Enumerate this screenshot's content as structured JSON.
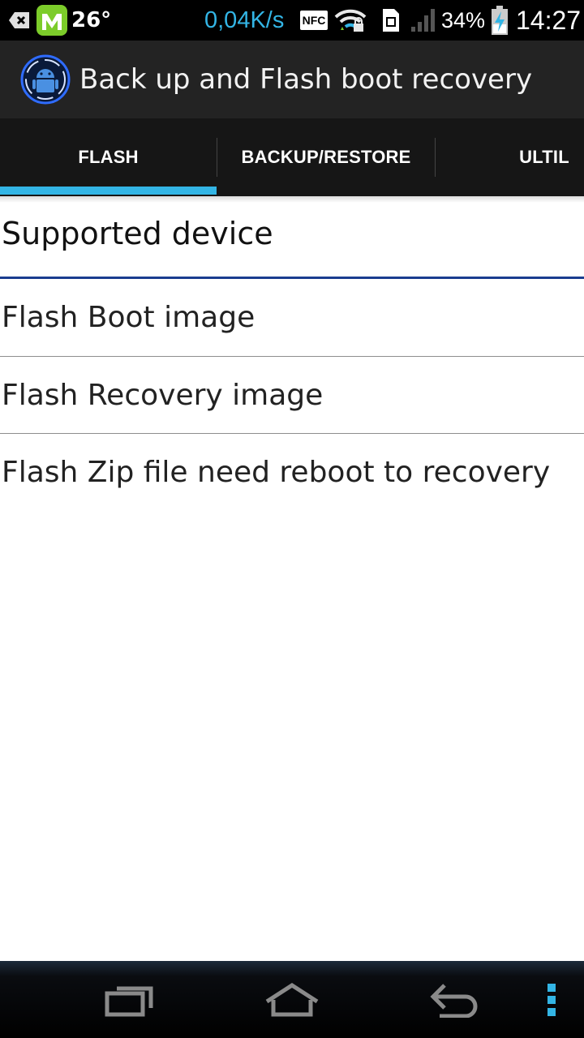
{
  "status_bar": {
    "temperature": "26°",
    "network_speed": "0,04K/s",
    "nfc_label": "NFC",
    "battery_percent": "34%",
    "clock": "14:27",
    "icons": [
      "back-badge-icon",
      "m-app-icon",
      "nfc-icon",
      "wifi-icon",
      "sim-card-icon",
      "signal-icon",
      "battery-charging-icon"
    ]
  },
  "action_bar": {
    "title": "Back up and Flash boot recovery",
    "icon": "android-app-icon"
  },
  "tabs": [
    {
      "label": "FLASH",
      "selected": true
    },
    {
      "label": "BACKUP/RESTORE",
      "selected": false
    },
    {
      "label": "ULTIL",
      "selected": false
    }
  ],
  "content": {
    "section_header": "Supported device",
    "items": [
      {
        "label": "Flash Boot image"
      },
      {
        "label": "Flash Recovery image"
      },
      {
        "label": "Flash Zip file need reboot to recovery"
      }
    ]
  },
  "nav_bar": {
    "buttons": [
      "recent-apps-icon",
      "home-icon",
      "back-icon",
      "overflow-menu-icon"
    ]
  },
  "colors": {
    "accent": "#33b5e5",
    "section_rule": "#1a3d8f",
    "action_bar_bg": "#232323",
    "tab_bar_bg": "#161616"
  }
}
